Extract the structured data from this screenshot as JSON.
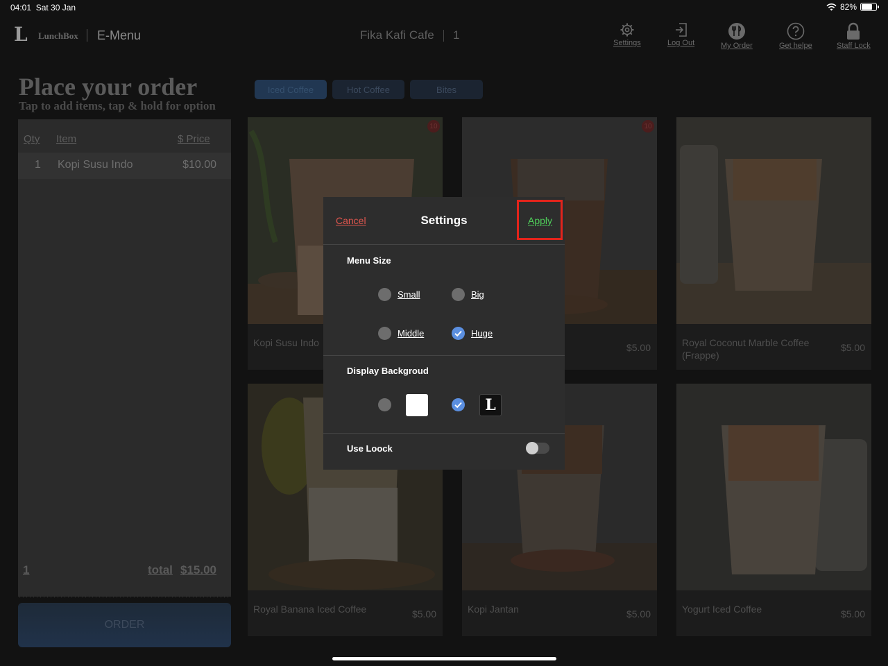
{
  "status_bar": {
    "time": "04:01",
    "date": "Sat 30 Jan",
    "battery": "82%",
    "battery_fraction": 0.82
  },
  "header": {
    "logo_text": "LunchBox",
    "app_title": "E-Menu",
    "cafe_name": "Fika Kafi Cafe",
    "table_number": "1",
    "nav": [
      {
        "label": "Settings",
        "icon": "gear-icon"
      },
      {
        "label": "Log Out",
        "icon": "logout-icon"
      },
      {
        "label": "My Order",
        "icon": "fork-knife-icon"
      },
      {
        "label": "Get helpe",
        "icon": "help-icon"
      },
      {
        "label": "Staff Lock",
        "icon": "lock-icon"
      }
    ]
  },
  "order_panel": {
    "headline": "Place your order",
    "subline": "Tap to add items, tap & hold for option",
    "columns": {
      "qty": "Qty",
      "item": "Item",
      "price": "$ Price"
    },
    "rows": [
      {
        "qty": "1",
        "item": "Kopi Susu Indo",
        "price": "$10.00"
      }
    ],
    "footer": {
      "count": "1",
      "total_label": "total",
      "total": "$15.00"
    },
    "order_button": "ORDER"
  },
  "tabs": [
    {
      "label": "Iced Coffee",
      "active": true
    },
    {
      "label": "Hot Coffee",
      "active": false
    },
    {
      "label": "Bites",
      "active": false
    }
  ],
  "menu_items": [
    {
      "name": "Kopi Susu Indo",
      "price": "",
      "badge": "10"
    },
    {
      "name": "",
      "price": "$5.00",
      "badge": "10"
    },
    {
      "name": "Royal Coconut Marble Coffee (Frappe)",
      "price": "$5.00",
      "badge": ""
    },
    {
      "name": "Royal Banana Iced Coffee",
      "price": "$5.00",
      "badge": ""
    },
    {
      "name": "Kopi Jantan",
      "price": "$5.00",
      "badge": ""
    },
    {
      "name": "Yogurt Iced Coffee",
      "price": "$5.00",
      "badge": ""
    }
  ],
  "settings_modal": {
    "cancel": "Cancel",
    "title": "Settings",
    "apply": "Apply",
    "menu_size": {
      "label": "Menu Size",
      "options": [
        {
          "label": "Small",
          "selected": false
        },
        {
          "label": "Big",
          "selected": false
        },
        {
          "label": "Middle",
          "selected": false
        },
        {
          "label": "Huge",
          "selected": true
        }
      ]
    },
    "display_background": {
      "label": "Display Backgroud",
      "options": [
        {
          "swatch": "white",
          "selected": false
        },
        {
          "swatch": "logo",
          "selected": true
        }
      ]
    },
    "use_lock": {
      "label": "Use Loock",
      "on": false
    }
  },
  "colors": {
    "accent_red": "#e0564e",
    "accent_green": "#4fcf5a",
    "highlight_border": "#e3241b",
    "radio_selected": "#5b8fe0"
  }
}
